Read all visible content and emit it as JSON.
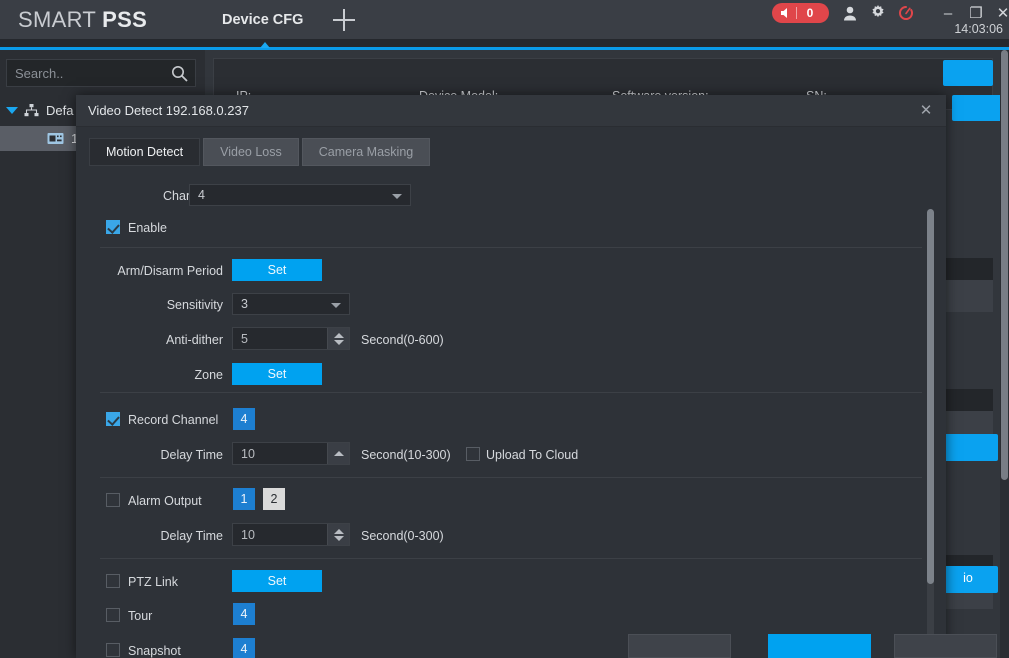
{
  "titlebar": {
    "logo_smart": "SMART ",
    "logo_pss": "PSS",
    "tab_label": "Device CFG",
    "add_tab_icon": "plus-icon",
    "alarm_count": "0",
    "alarm_icon": "speaker-icon",
    "user_icon": "user-icon",
    "settings_icon": "gear-icon",
    "dashboard_icon": "speedometer-icon",
    "minimize_label": "–",
    "maximize_label": "❐",
    "close_label": "✕",
    "clock": "14:03:06"
  },
  "sidebar": {
    "search_placeholder": "Search..",
    "search_value": "",
    "search_icon": "search-icon",
    "tree": [
      {
        "label": "Defa",
        "icon": "org-tree-icon",
        "caret": "caret-down-icon",
        "selected": false
      },
      {
        "label": "1",
        "icon": "device-icon",
        "selected": true
      }
    ]
  },
  "background": {
    "device_fields": [
      "IP:",
      "Device Model:",
      "Software version:",
      "SN:"
    ],
    "buttons": [
      "",
      "",
      "",
      "io"
    ]
  },
  "dialog": {
    "title": "Video Detect 192.168.0.237",
    "close_label": "✕",
    "tabs": [
      {
        "label": "Motion Detect",
        "active": true
      },
      {
        "label": "Video Loss",
        "active": false
      },
      {
        "label": "Camera Masking",
        "active": false
      }
    ],
    "channel_no": {
      "label": "Channel No.:",
      "value": "4"
    },
    "enable": {
      "label": "Enable",
      "checked": true
    },
    "arm_disarm": {
      "label": "Arm/Disarm Period",
      "button": "Set"
    },
    "sensitivity": {
      "label": "Sensitivity",
      "value": "3"
    },
    "anti_dither": {
      "label": "Anti-dither",
      "value": "5",
      "unit": "Second(0-600)"
    },
    "zone": {
      "label": "Zone",
      "button": "Set"
    },
    "record_channel": {
      "label": "Record Channel",
      "checked": true,
      "channels": [
        "4"
      ],
      "delay_label": "Delay Time",
      "delay_value": "10",
      "delay_unit": "Second(10-300)",
      "upload_label": "Upload To Cloud",
      "upload_checked": false
    },
    "alarm_output": {
      "label": "Alarm Output",
      "checked": false,
      "channels": [
        "1",
        "2"
      ],
      "delay_label": "Delay Time",
      "delay_value": "10",
      "delay_unit": "Second(0-300)"
    },
    "ptz_link": {
      "label": "PTZ Link",
      "checked": false,
      "button": "Set"
    },
    "tour": {
      "label": "Tour",
      "checked": false,
      "channels": [
        "4"
      ]
    },
    "snapshot": {
      "label": "Snapshot",
      "checked": false,
      "channels": [
        "4"
      ]
    }
  },
  "colors": {
    "accent_blue": "#00a2f0",
    "channel_blue": "#1d7fd1",
    "alarm_red": "#e0464a",
    "titlebar_line": "#0a9ae8"
  }
}
